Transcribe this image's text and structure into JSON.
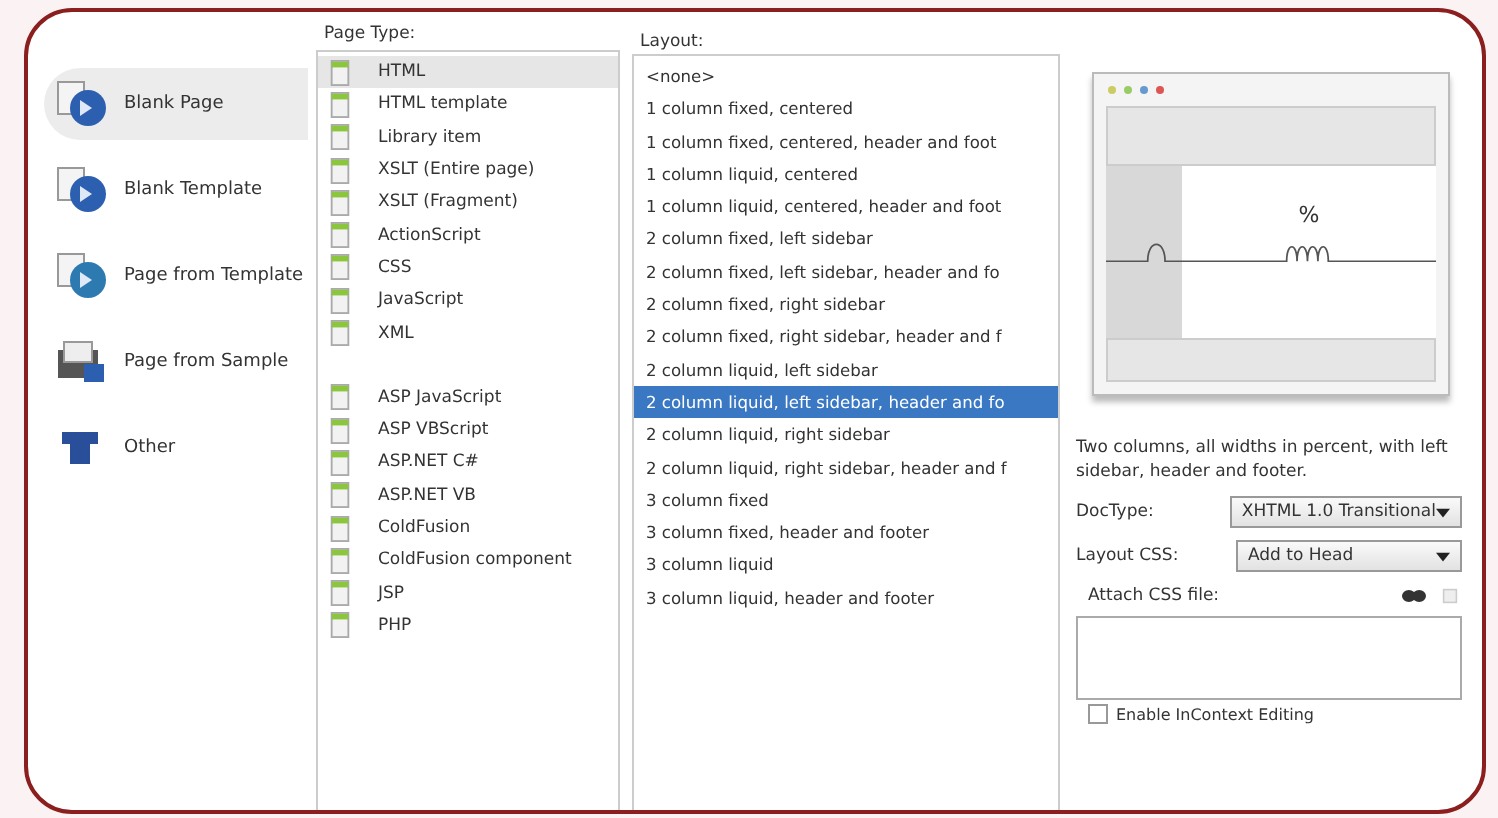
{
  "categories": [
    {
      "label": "Blank Page",
      "kind": "blank",
      "selected": true
    },
    {
      "label": "Blank Template",
      "kind": "blank",
      "selected": false
    },
    {
      "label": "Page from Template",
      "kind": "template",
      "selected": false
    },
    {
      "label": "Page from Sample",
      "kind": "sample",
      "selected": false
    },
    {
      "label": "Other",
      "kind": "other",
      "selected": false
    }
  ],
  "page_type": {
    "heading": "Page Type:",
    "groups": [
      {
        "items": [
          {
            "label": "HTML",
            "selected": true
          },
          {
            "label": "HTML template",
            "selected": false
          },
          {
            "label": "Library item",
            "selected": false
          },
          {
            "label": "XSLT (Entire page)",
            "selected": false
          },
          {
            "label": "XSLT (Fragment)",
            "selected": false
          },
          {
            "label": "ActionScript",
            "selected": false
          },
          {
            "label": "CSS",
            "selected": false
          },
          {
            "label": "JavaScript",
            "selected": false
          },
          {
            "label": "XML",
            "selected": false
          }
        ]
      },
      {
        "items": [
          {
            "label": "ASP JavaScript",
            "selected": false
          },
          {
            "label": "ASP VBScript",
            "selected": false
          },
          {
            "label": "ASP.NET C#",
            "selected": false
          },
          {
            "label": "ASP.NET VB",
            "selected": false
          },
          {
            "label": "ColdFusion",
            "selected": false
          },
          {
            "label": "ColdFusion component",
            "selected": false
          },
          {
            "label": "JSP",
            "selected": false
          },
          {
            "label": "PHP",
            "selected": false
          }
        ]
      }
    ]
  },
  "layout": {
    "heading": "Layout:",
    "items": [
      {
        "label": "<none>",
        "selected": false
      },
      {
        "label": "1 column fixed, centered",
        "selected": false
      },
      {
        "label": "1 column fixed, centered, header and foot",
        "selected": false
      },
      {
        "label": "1 column liquid, centered",
        "selected": false
      },
      {
        "label": "1 column liquid, centered, header and foot",
        "selected": false
      },
      {
        "label": "2 column fixed, left sidebar",
        "selected": false
      },
      {
        "label": "2 column fixed, left sidebar, header and fo",
        "selected": false
      },
      {
        "label": "2 column fixed, right sidebar",
        "selected": false
      },
      {
        "label": "2 column fixed, right sidebar, header and f",
        "selected": false
      },
      {
        "label": "2 column liquid, left sidebar",
        "selected": false
      },
      {
        "label": "2 column liquid, left sidebar, header and fo",
        "selected": true
      },
      {
        "label": "2 column liquid, right sidebar",
        "selected": false
      },
      {
        "label": "2 column liquid, right sidebar, header and f",
        "selected": false
      },
      {
        "label": "3 column fixed",
        "selected": false
      },
      {
        "label": "3 column fixed, header and footer",
        "selected": false
      },
      {
        "label": "3 column liquid",
        "selected": false
      },
      {
        "label": "3 column liquid, header and footer",
        "selected": false
      }
    ]
  },
  "preview": {
    "label": "%",
    "description": "Two columns, all widths in percent, with left sidebar, header and footer."
  },
  "doctype": {
    "label": "DocType:",
    "value": "XHTML 1.0 Transitional"
  },
  "layout_css": {
    "label": "Layout CSS:",
    "value": "Add to Head"
  },
  "attach_css": {
    "label": "Attach CSS file:"
  },
  "incontext": {
    "label": "Enable InContext Editing",
    "checked": false
  }
}
